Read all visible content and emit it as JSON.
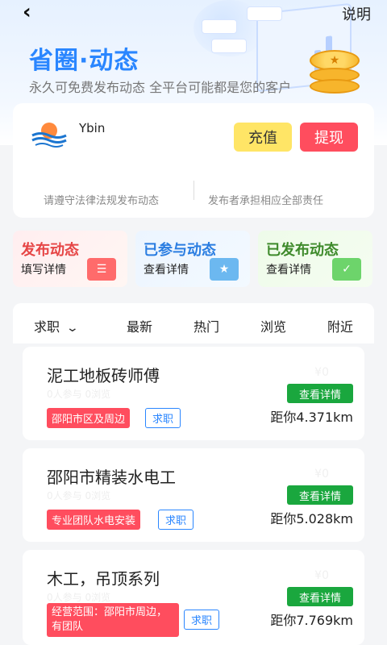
{
  "nav": {
    "help_label": "说明"
  },
  "hero": {
    "title": "省圈·动态",
    "subtitle": "永久可免费发布动态 全平台可能都是您的客户"
  },
  "account": {
    "user_name": "Ybin",
    "recharge_label": "充值",
    "withdraw_label": "提现",
    "notice_left": "请遵守法律法规发布动态",
    "notice_right": "发布者承担相应全部责任"
  },
  "features": [
    {
      "title": "发布动态",
      "subtitle": "填写详情"
    },
    {
      "title": "已参与动态",
      "subtitle": "查看详情"
    },
    {
      "title": "已发布动态",
      "subtitle": "查看详情"
    }
  ],
  "filters": {
    "dropdown_label": "求职",
    "tabs": [
      "最新",
      "热门",
      "浏览",
      "附近"
    ]
  },
  "jobs": [
    {
      "title": "泥工地板砖师傅",
      "stats": "0人参与 0浏览",
      "price": "¥0",
      "area_tag": "邵阳市区及周边",
      "type_tag": "求职",
      "detail_label": "查看详情",
      "distance": "距你4.371km"
    },
    {
      "title": "邵阳市精装水电工",
      "stats": "0人参与 0浏览",
      "price": "¥0",
      "area_tag": "专业团队水电安装",
      "type_tag": "求职",
      "detail_label": "查看详情",
      "distance": "距你5.028km"
    },
    {
      "title": "木工，吊顶系列",
      "stats": "0人参与 0浏览",
      "price": "¥0",
      "area_tag": "经营范围：邵阳市周边，有团队",
      "type_tag": "求职",
      "detail_label": "查看详情",
      "distance": "距你7.769km"
    }
  ]
}
